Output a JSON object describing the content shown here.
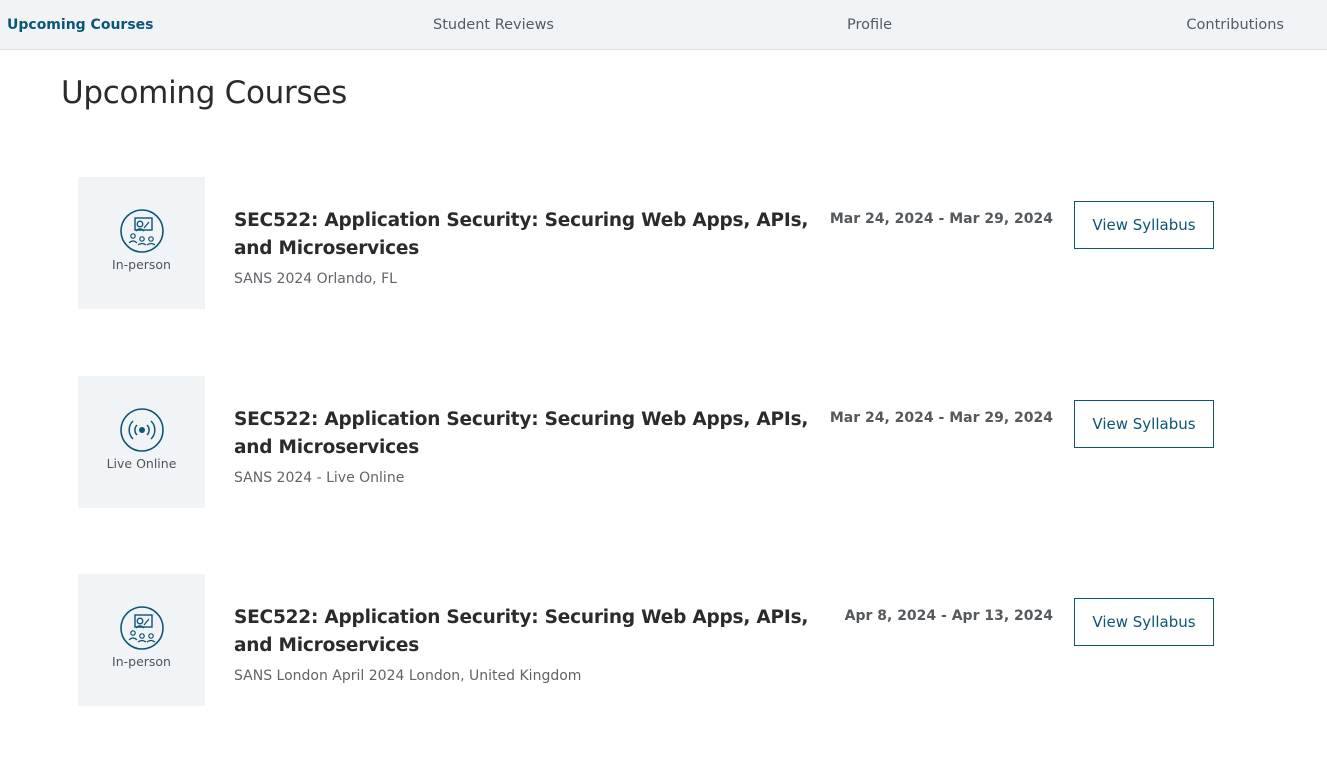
{
  "nav": {
    "tabs": [
      {
        "label": "Upcoming Courses",
        "active": true
      },
      {
        "label": "Student Reviews",
        "active": false
      },
      {
        "label": "Profile",
        "active": false
      },
      {
        "label": "Contributions",
        "active": false
      }
    ]
  },
  "page": {
    "title": "Upcoming Courses"
  },
  "courses": [
    {
      "format": "In-person",
      "icon": "in-person-icon",
      "title": "SEC522: Application Security: Securing Web Apps, APIs, and Microservices",
      "location": "SANS 2024 Orlando, FL",
      "dates": "Mar 24, 2024 - Mar 29, 2024",
      "button_label": "View Syllabus"
    },
    {
      "format": "Live Online",
      "icon": "live-online-icon",
      "title": "SEC522: Application Security: Securing Web Apps, APIs, and Microservices",
      "location": "SANS 2024 - Live Online",
      "dates": "Mar 24, 2024 - Mar 29, 2024",
      "button_label": "View Syllabus"
    },
    {
      "format": "In-person",
      "icon": "in-person-icon",
      "title": "SEC522: Application Security: Securing Web Apps, APIs, and Microservices",
      "location": "SANS London April 2024 London, United Kingdom",
      "dates": "Apr 8, 2024 - Apr 13, 2024",
      "button_label": "View Syllabus"
    }
  ],
  "colors": {
    "accent": "#0b5575",
    "nav_background": "#f1f4f7",
    "thumb_background": "#f1f4f7",
    "text": "#2b2b2b"
  }
}
